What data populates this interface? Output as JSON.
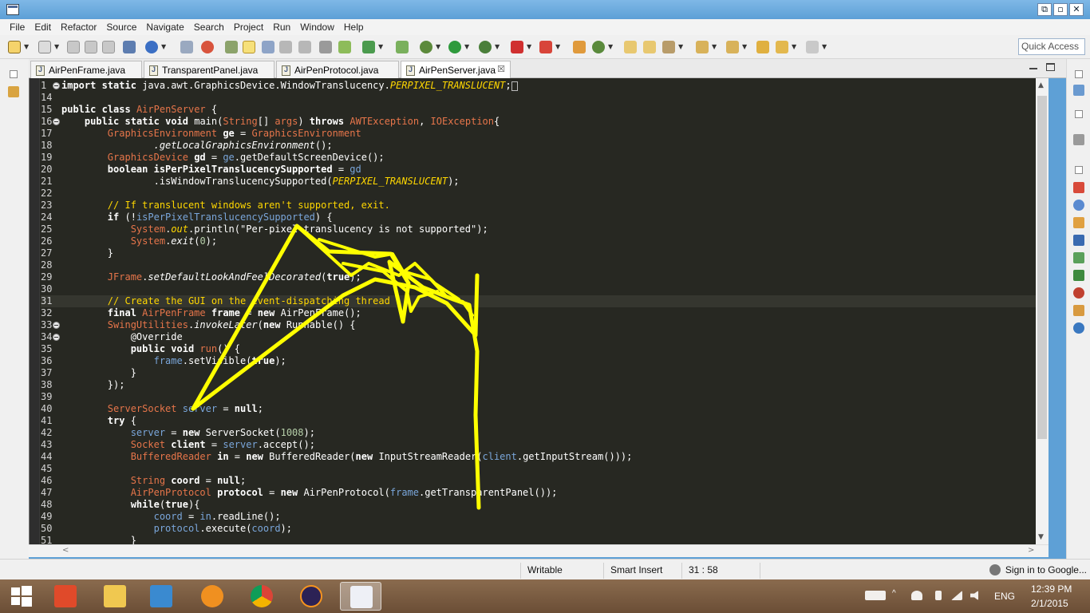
{
  "window": {
    "minimize_label": "⧉",
    "restore_label": "▫",
    "close_label": "✕"
  },
  "menu": [
    "File",
    "Edit",
    "Refactor",
    "Source",
    "Navigate",
    "Search",
    "Project",
    "Run",
    "Window",
    "Help"
  ],
  "toolbar": {
    "quick_access": "Quick Access"
  },
  "tabs": [
    {
      "label": "AirPenFrame.java",
      "active": false
    },
    {
      "label": "TransparentPanel.java",
      "active": false
    },
    {
      "label": "AirPenProtocol.java",
      "active": false
    },
    {
      "label": "AirPenServer.java",
      "active": true,
      "close": "☒"
    }
  ],
  "code": [
    {
      "ln": "1",
      "fold": true,
      "html": "<span class='k'>import</span> <span class='k'>static</span> <span class='code-text'>java.awt.GraphicsDevice.WindowTranslucency.</span><span class='ic'>PERPIXEL_TRANSLUCENT</span><span class='code-text'>;</span><span class='cursorbox'></span>"
    },
    {
      "ln": "14",
      "html": ""
    },
    {
      "ln": "15",
      "html": "<span class='k'>public</span> <span class='k'>class</span> <span class='t'>AirPenServer</span> <span class='code-text'>{</span>"
    },
    {
      "ln": "16",
      "fold": true,
      "html": "    <span class='k'>public</span> <span class='k'>static</span> <span class='k'>void</span> <span class='code-text'>main(</span><span class='t'>String</span><span class='code-text'>[] </span><span class='t'>args</span><span class='code-text'>) </span><span class='k'>throws</span> <span class='t'>AWTException</span><span class='code-text'>, </span><span class='t'>IOException</span><span class='code-text'>{</span>"
    },
    {
      "ln": "17",
      "html": "        <span class='t'>GraphicsEnvironment</span> <span class='v'>ge</span> <span class='code-text'>= </span><span class='t'>GraphicsEnvironment</span>"
    },
    {
      "ln": "18",
      "html": "                <span class='code-text i'>.getLocalGraphicsEnvironment</span><span class='code-text'>();</span>"
    },
    {
      "ln": "19",
      "html": "        <span class='t'>GraphicsDevice</span> <span class='v'>gd</span> <span class='code-text'>= </span><span class='f'>ge</span><span class='code-text'>.getDefaultScreenDevice();</span>"
    },
    {
      "ln": "20",
      "html": "        <span class='k'>boolean</span> <span class='v'>isPerPixelTranslucencySupported</span> <span class='code-text'>= </span><span class='f'>gd</span>"
    },
    {
      "ln": "21",
      "html": "                <span class='code-text'>.isWindowTranslucencySupported(</span><span class='ic'>PERPIXEL_TRANSLUCENT</span><span class='code-text'>);</span>"
    },
    {
      "ln": "22",
      "html": ""
    },
    {
      "ln": "23",
      "html": "        <span class='c'>// If translucent windows aren't supported, exit.</span>"
    },
    {
      "ln": "24",
      "html": "        <span class='k'>if</span> <span class='code-text'>(!</span><span class='f'>isPerPixelTranslucencySupported</span><span class='code-text'>) {</span>"
    },
    {
      "ln": "25",
      "html": "            <span class='t'>System</span><span class='code-text'>.</span><span class='ic'>out</span><span class='code-text'>.println(</span><span class='s'>\"Per-pixel translucency is not supported\"</span><span class='code-text'>);</span>"
    },
    {
      "ln": "26",
      "html": "            <span class='t'>System</span><span class='code-text'>.</span><span class='code-text i'>exit</span><span class='code-text'>(</span><span class='n'>0</span><span class='code-text'>);</span>"
    },
    {
      "ln": "27",
      "html": "        <span class='code-text'>}</span>"
    },
    {
      "ln": "28",
      "html": ""
    },
    {
      "ln": "29",
      "html": "        <span class='t'>JFrame</span><span class='code-text'>.</span><span class='code-text i'>setDefaultLookAndFeelDecorated</span><span class='code-text'>(</span><span class='k'>true</span><span class='code-text'>);</span>"
    },
    {
      "ln": "30",
      "html": ""
    },
    {
      "ln": "31",
      "cur": true,
      "html": "        <span class='c'>// Create the GUI on the event-dispatching thread</span>"
    },
    {
      "ln": "32",
      "html": "        <span class='k'>final</span> <span class='t'>AirPenFrame</span> <span class='v'>frame</span> <span class='code-text'>= </span><span class='k'>new</span> <span class='code-text'>AirPenFrame();</span>"
    },
    {
      "ln": "33",
      "fold": true,
      "html": "        <span class='t'>SwingUtilities</span><span class='code-text'>.</span><span class='code-text i'>invokeLater</span><span class='code-text'>(</span><span class='k'>new</span> <span class='code-text'>Runnable() {</span>"
    },
    {
      "ln": "34",
      "fold": true,
      "html": "            <span class='code-text'>@Override</span>"
    },
    {
      "ln": "35",
      "html": "            <span class='k'>public</span> <span class='k'>void</span> <span class='t'>run</span><span class='code-text'>() {</span>"
    },
    {
      "ln": "36",
      "html": "                <span class='f'>frame</span><span class='code-text'>.setVisible(</span><span class='k'>true</span><span class='code-text'>);</span>"
    },
    {
      "ln": "37",
      "html": "            <span class='code-text'>}</span>"
    },
    {
      "ln": "38",
      "html": "        <span class='code-text'>});</span>"
    },
    {
      "ln": "39",
      "html": ""
    },
    {
      "ln": "40",
      "html": "        <span class='t'>ServerSocket</span> <span class='f'>server</span> <span class='code-text'>= </span><span class='k'>null</span><span class='code-text'>;</span>"
    },
    {
      "ln": "41",
      "html": "        <span class='k'>try</span> <span class='code-text'>{</span>"
    },
    {
      "ln": "42",
      "html": "            <span class='f'>server</span> <span class='code-text'>= </span><span class='k'>new</span> <span class='code-text'>ServerSocket(</span><span class='n'>1008</span><span class='code-text'>);</span>"
    },
    {
      "ln": "43",
      "html": "            <span class='t'>Socket</span> <span class='v'>client</span> <span class='code-text'>= </span><span class='f'>server</span><span class='code-text'>.accept();</span>"
    },
    {
      "ln": "44",
      "html": "            <span class='t'>BufferedReader</span> <span class='v'>in</span> <span class='code-text'>= </span><span class='k'>new</span> <span class='code-text'>BufferedReader(</span><span class='k'>new</span> <span class='code-text'>InputStreamReader(</span><span class='f'>client</span><span class='code-text'>.getInputStream()));</span>"
    },
    {
      "ln": "45",
      "html": ""
    },
    {
      "ln": "46",
      "html": "            <span class='t'>String</span> <span class='v'>coord</span> <span class='code-text'>= </span><span class='k'>null</span><span class='code-text'>;</span>"
    },
    {
      "ln": "47",
      "html": "            <span class='t'>AirPenProtocol</span> <span class='v'>protocol</span> <span class='code-text'>= </span><span class='k'>new</span> <span class='code-text'>AirPenProtocol(</span><span class='f'>frame</span><span class='code-text'>.getTransparentPanel());</span>"
    },
    {
      "ln": "48",
      "html": "            <span class='k'>while</span><span class='code-text'>(</span><span class='k'>true</span><span class='code-text'>){</span>"
    },
    {
      "ln": "49",
      "html": "                <span class='f'>coord</span> <span class='code-text'>= </span><span class='f'>in</span><span class='code-text'>.readLine();</span>"
    },
    {
      "ln": "50",
      "html": "                <span class='f'>protocol</span><span class='code-text'>.execute(</span><span class='f'>coord</span><span class='code-text'>);</span>"
    },
    {
      "ln": "51",
      "html": "            <span class='code-text'>}</span>"
    }
  ],
  "status": {
    "writable": "Writable",
    "insert_mode": "Smart Insert",
    "position": "31 : 58",
    "signin": "Sign in to Google..."
  },
  "taskbar": {
    "language": "ENG",
    "time": "12:39 PM",
    "date": "2/1/2015"
  },
  "colors": {
    "editor_bg": "#272822",
    "annotation": "#ffff00",
    "taskbar": "#7a5a40"
  }
}
